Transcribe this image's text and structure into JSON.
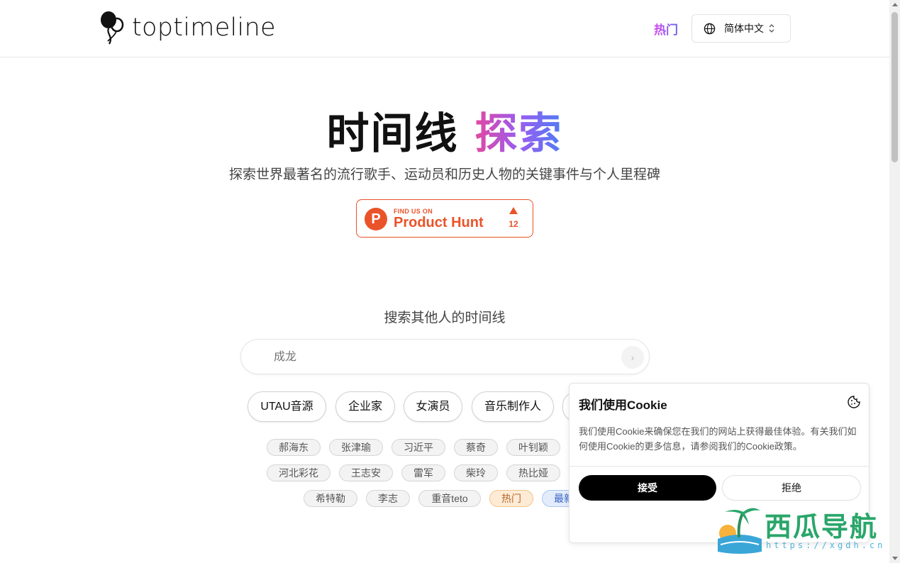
{
  "header": {
    "logo_text": "toptimeline",
    "nav_hot": "热门",
    "lang_label": "简体中文"
  },
  "hero": {
    "title_main": "时间线",
    "title_accent": "探索",
    "subtitle": "探索世界最著名的流行歌手、运动员和历史人物的关键事件与个人里程碑"
  },
  "product_hunt": {
    "small": "FIND US ON",
    "big": "Product Hunt",
    "count": "12"
  },
  "search": {
    "label": "搜索其他人的时间线",
    "placeholder": "成龙"
  },
  "categories": [
    "UTAU音源",
    "企业家",
    "女演员",
    "音乐制作人"
  ],
  "tags_row1": [
    "郝海东",
    "张津瑜",
    "习近平",
    "蔡奇",
    "叶钊颖"
  ],
  "tags_row2": [
    "河北彩花",
    "王志安",
    "雷军",
    "柴玲",
    "热比娅"
  ],
  "tags_row3": [
    "希特勒",
    "李志",
    "重音teto",
    "热门",
    "最新"
  ],
  "cookie": {
    "title": "我们使用Cookie",
    "text": "我们使用Cookie来确保您在我们的网站上获得最佳体验。有关我们如何使用Cookie的更多信息，请参阅我们的Cookie政策。",
    "accept": "接受",
    "reject": "拒绝"
  },
  "watermark": {
    "text": "西瓜导航",
    "url": "https://xgdh.cn"
  },
  "colors": {
    "accent_gradient_start": "#e2489f",
    "accent_gradient_end": "#4f7cf4",
    "product_hunt": "#ea532a"
  }
}
